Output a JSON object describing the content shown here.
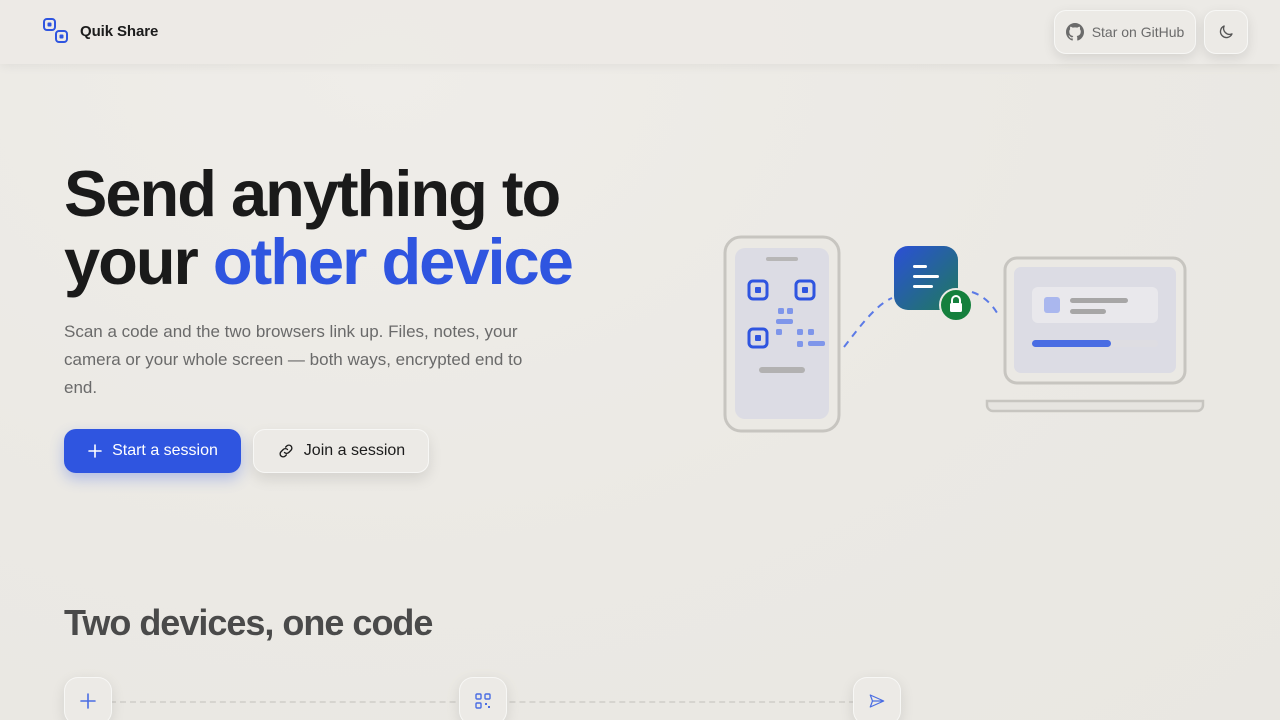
{
  "header": {
    "brand": "Quik Share",
    "github_label": "Star on GitHub"
  },
  "hero": {
    "title_line1": "Send anything to",
    "title_line2_plain": "your ",
    "title_line2_accent": "other device",
    "subtitle": "Scan a code and the two browsers link up. Files, notes, your camera or your whole screen — both ways, encrypted end to end.",
    "primary_button": "Start a session",
    "secondary_button": "Join a session"
  },
  "section": {
    "title": "Two devices, one code",
    "step_icons": [
      "plus-icon",
      "qr-code-icon",
      "send-icon"
    ]
  },
  "colors": {
    "accent": "#2f55e0",
    "background": "#ebe9e4",
    "lock_badge": "#15803d"
  },
  "icons": {
    "brand": "link-squares-logo",
    "github": "github-icon",
    "theme": "moon-icon",
    "primary": "plus-icon",
    "secondary": "link-icon"
  }
}
